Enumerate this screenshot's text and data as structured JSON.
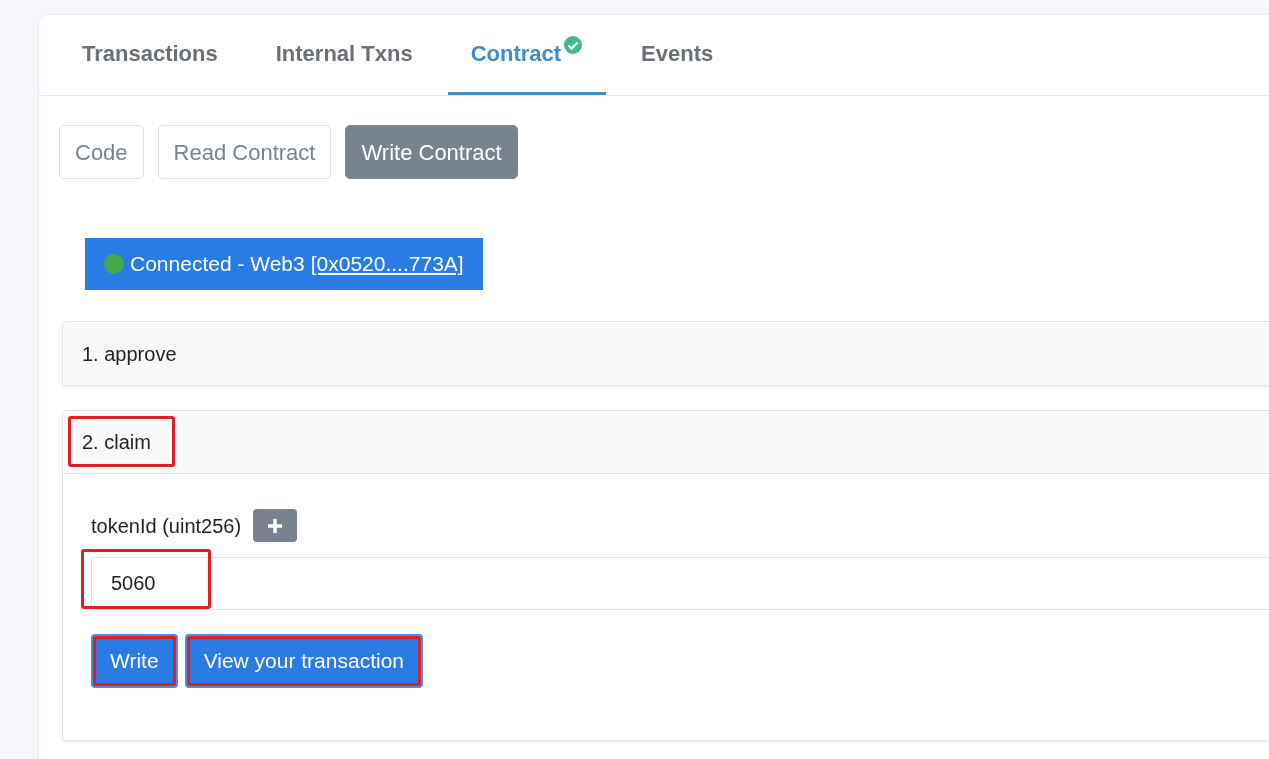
{
  "tabs": [
    {
      "label": "Transactions",
      "selected": false,
      "verified": false
    },
    {
      "label": "Internal Txns",
      "selected": false,
      "verified": false
    },
    {
      "label": "Contract",
      "selected": true,
      "verified": true
    },
    {
      "label": "Events",
      "selected": false,
      "verified": false
    }
  ],
  "sub_tabs": [
    {
      "label": "Code",
      "selected": false
    },
    {
      "label": "Read Contract",
      "selected": false
    },
    {
      "label": "Write Contract",
      "selected": true
    }
  ],
  "connection": {
    "connected": true,
    "text": "Connected - Web3",
    "address": "[0x0520....773A]"
  },
  "functions": [
    {
      "title": "1. approve",
      "expanded": false,
      "highlighted": false
    },
    {
      "title": "2. claim",
      "expanded": true,
      "highlighted": true,
      "inputs": [
        {
          "label": "tokenId (uint256)",
          "value": "5060",
          "highlighted": true
        }
      ],
      "buttons": [
        {
          "label": "Write",
          "highlighted": true
        },
        {
          "label": "View your transaction",
          "highlighted": true
        }
      ]
    }
  ]
}
